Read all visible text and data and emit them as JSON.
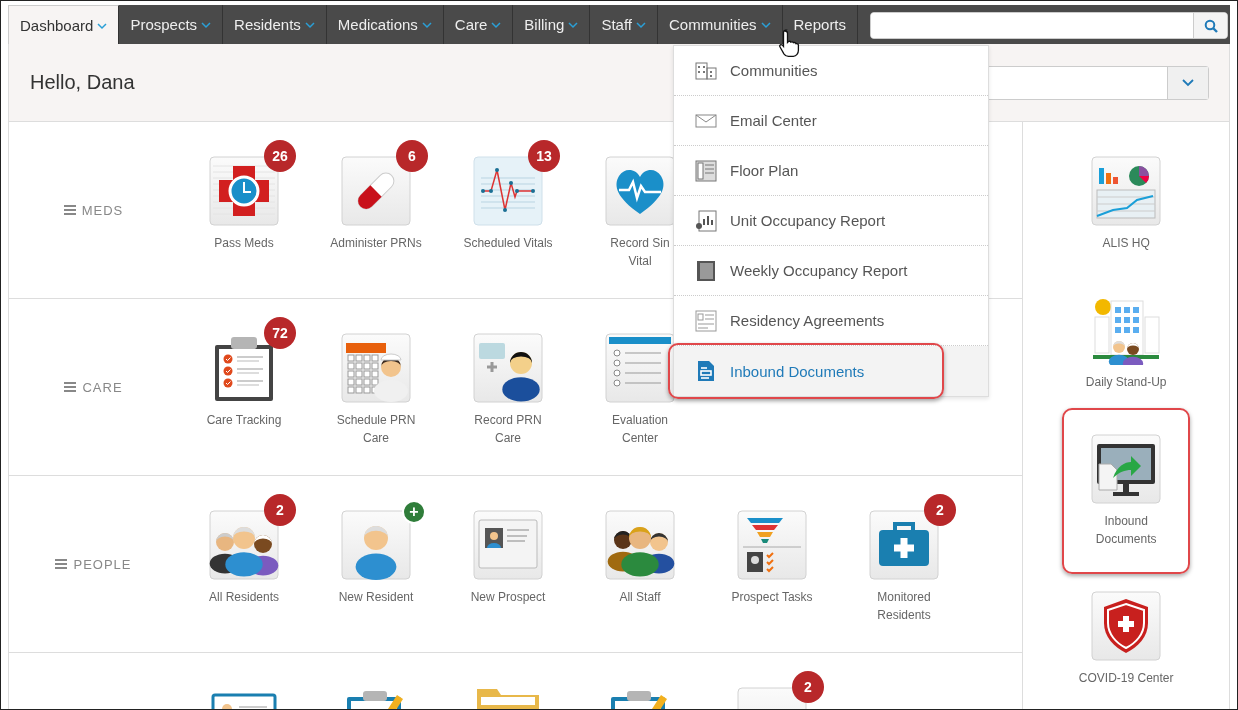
{
  "nav": {
    "tabs": [
      {
        "label": "Dashboard",
        "selected": true,
        "has_menu": true
      },
      {
        "label": "Prospects",
        "selected": false,
        "has_menu": true
      },
      {
        "label": "Residents",
        "selected": false,
        "has_menu": true
      },
      {
        "label": "Medications",
        "selected": false,
        "has_menu": true
      },
      {
        "label": "Care",
        "selected": false,
        "has_menu": true
      },
      {
        "label": "Billing",
        "selected": false,
        "has_menu": true
      },
      {
        "label": "Staff",
        "selected": false,
        "has_menu": true
      },
      {
        "label": "Communities",
        "selected": false,
        "has_menu": true
      },
      {
        "label": "Reports",
        "selected": false,
        "has_menu": false
      }
    ]
  },
  "greeting": "Hello, Dana",
  "communities_menu": {
    "items": [
      {
        "label": "Communities",
        "selected": false,
        "highlighted": false
      },
      {
        "label": "Email Center",
        "selected": false,
        "highlighted": false
      },
      {
        "label": "Floor Plan",
        "selected": false,
        "highlighted": false
      },
      {
        "label": "Unit Occupancy Report",
        "selected": false,
        "highlighted": false
      },
      {
        "label": "Weekly Occupancy Report",
        "selected": false,
        "highlighted": false
      },
      {
        "label": "Residency Agreements",
        "selected": false,
        "highlighted": false
      },
      {
        "label": "Inbound Documents",
        "selected": true,
        "highlighted": true
      }
    ]
  },
  "sections": [
    {
      "label": "MEDS",
      "tiles": [
        {
          "label": "Pass Meds",
          "badge": {
            "text": "26",
            "kind": "count"
          }
        },
        {
          "label": "Administer PRNs",
          "badge": {
            "text": "6",
            "kind": "count"
          }
        },
        {
          "label": "Scheduled Vitals",
          "badge": {
            "text": "13",
            "kind": "count"
          }
        },
        {
          "label": "Record Sin\nVital"
        }
      ]
    },
    {
      "label": "CARE",
      "tiles": [
        {
          "label": "Care Tracking",
          "badge": {
            "text": "72",
            "kind": "count"
          }
        },
        {
          "label": "Schedule PRN\nCare"
        },
        {
          "label": "Record PRN\nCare"
        },
        {
          "label": "Evaluation\nCenter"
        }
      ]
    },
    {
      "label": "PEOPLE",
      "tiles": [
        {
          "label": "All Residents",
          "badge": {
            "text": "2",
            "kind": "count"
          }
        },
        {
          "label": "New Resident",
          "badge": {
            "text": "+",
            "kind": "add"
          }
        },
        {
          "label": "New Prospect"
        },
        {
          "label": "All Staff"
        },
        {
          "label": "Prospect Tasks"
        },
        {
          "label": "Monitored\nResidents",
          "badge": {
            "text": "2",
            "kind": "count"
          }
        }
      ]
    }
  ],
  "cut_off_row": {
    "last_tile_badge": {
      "text": "2",
      "kind": "count"
    }
  },
  "sidebar": {
    "tiles": [
      {
        "label": "ALIS HQ",
        "highlighted": false
      },
      {
        "label": "Daily Stand-Up",
        "highlighted": false
      },
      {
        "label": "Inbound\nDocuments",
        "highlighted": true
      },
      {
        "label": "COVID-19 Center",
        "highlighted": false
      }
    ]
  }
}
